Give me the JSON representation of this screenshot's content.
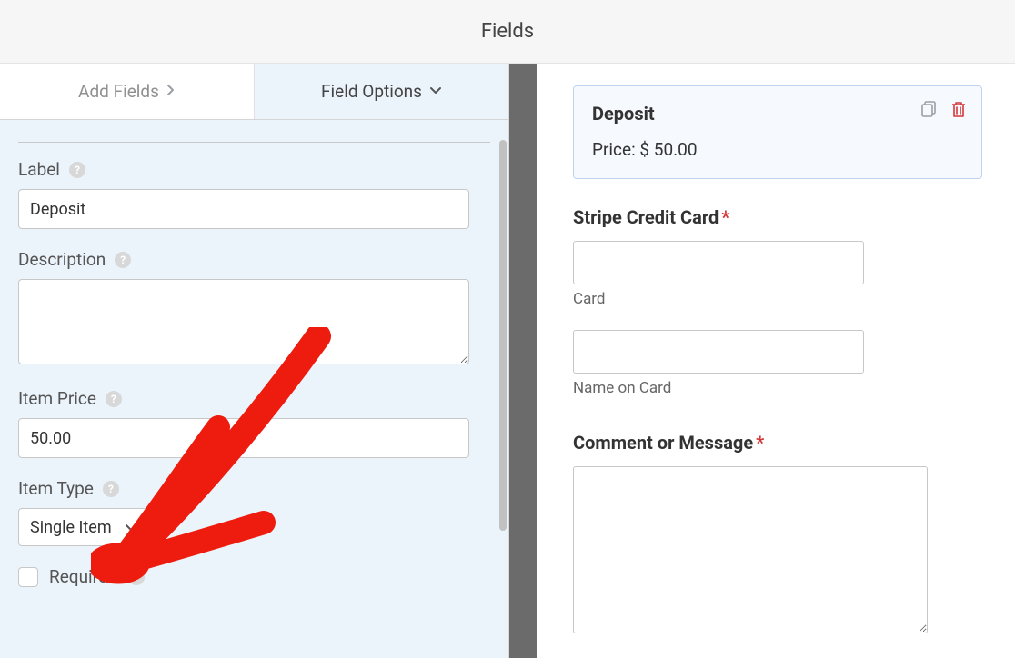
{
  "header": {
    "title": "Fields"
  },
  "tabs": {
    "add": "Add Fields",
    "options": "Field Options"
  },
  "options": {
    "label": {
      "title": "Label",
      "value": "Deposit"
    },
    "description": {
      "title": "Description",
      "value": ""
    },
    "item_price": {
      "title": "Item Price",
      "value": "50.00"
    },
    "item_type": {
      "title": "Item Type",
      "value": "Single Item"
    },
    "required": {
      "title": "Required",
      "checked": false
    }
  },
  "preview": {
    "deposit_title": "Deposit",
    "deposit_price_text": "Price: $ 50.00",
    "stripe_title": "Stripe Credit Card",
    "card_label": "Card",
    "name_label": "Name on Card",
    "comment_title": "Comment or Message"
  },
  "colors": {
    "accent_red": "#ee1c0e",
    "panel_bg": "#ecf4fb"
  }
}
